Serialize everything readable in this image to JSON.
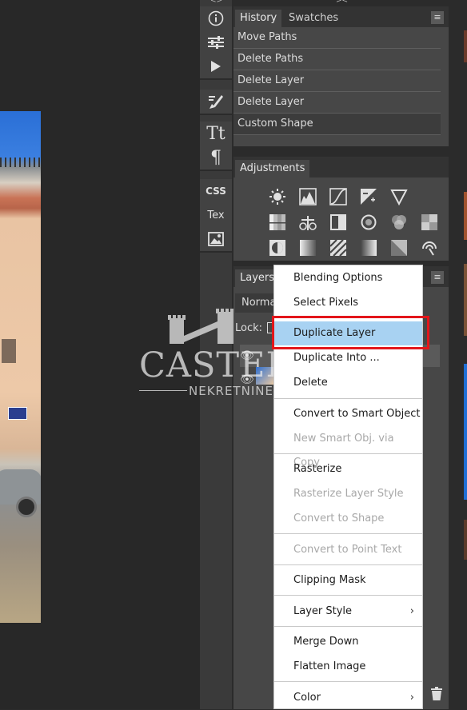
{
  "history": {
    "tabs": [
      "History",
      "Swatches"
    ],
    "items": [
      "Move Paths",
      "Delete Paths",
      "Delete Layer",
      "Delete Layer",
      "Custom Shape"
    ]
  },
  "adjustments": {
    "tab": "Adjustments"
  },
  "layers": {
    "tab": "Layers",
    "blend_mode": "Norma",
    "lock_label": "Lock:"
  },
  "tools": {
    "css": "CSS",
    "tex": "Tex"
  },
  "watermark": {
    "main": "CASTEL",
    "sub": "NEKRETNINE"
  },
  "context_menu": {
    "items": [
      {
        "label": "Blending Options",
        "enabled": true
      },
      {
        "label": "Select Pixels",
        "enabled": true
      },
      {
        "label": "Duplicate Layer",
        "enabled": true,
        "highlighted": true
      },
      {
        "label": "Duplicate Into ...",
        "enabled": true
      },
      {
        "label": "Delete",
        "enabled": true
      },
      {
        "label": "Convert to Smart Object",
        "enabled": true
      },
      {
        "label": "New Smart Obj. via Copy",
        "enabled": false
      },
      {
        "label": "Rasterize",
        "enabled": true
      },
      {
        "label": "Rasterize Layer Style",
        "enabled": false
      },
      {
        "label": "Convert to Shape",
        "enabled": false
      },
      {
        "label": "Convert to Point Text",
        "enabled": false
      },
      {
        "label": "Clipping Mask",
        "enabled": true
      },
      {
        "label": "Layer Style",
        "enabled": true,
        "submenu": true
      },
      {
        "label": "Merge Down",
        "enabled": true
      },
      {
        "label": "Flatten Image",
        "enabled": true
      },
      {
        "label": "Color",
        "enabled": true,
        "submenu": true
      }
    ]
  },
  "colors": {
    "highlight_outline": "#e3161b",
    "hover": "#a8d2f2"
  }
}
